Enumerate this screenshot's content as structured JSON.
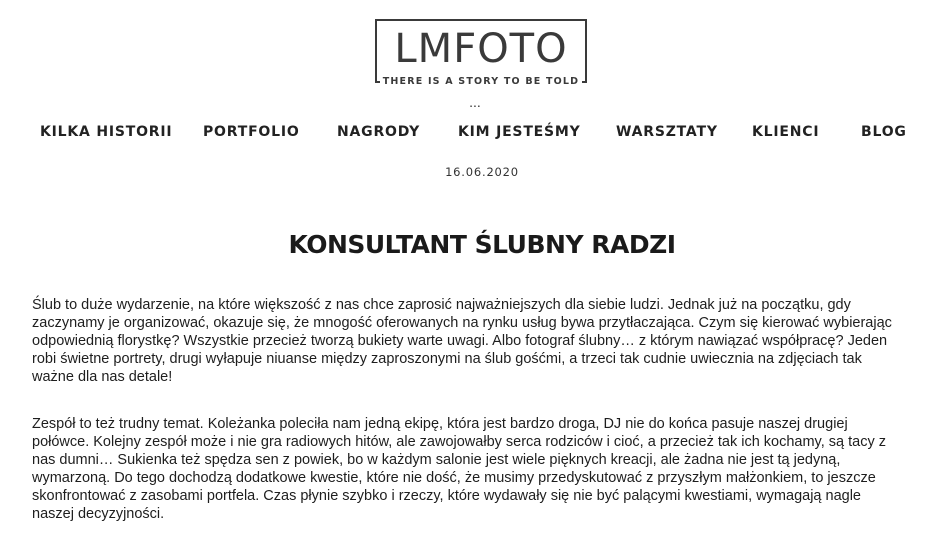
{
  "header": {
    "logo": {
      "wordmark": "LMFOTO",
      "tagline": "THERE IS A STORY TO BE TOLD"
    },
    "ellipsis": "..."
  },
  "nav": {
    "items": [
      {
        "label": "KILKA HISTORII"
      },
      {
        "label": "PORTFOLIO"
      },
      {
        "label": "NAGRODY"
      },
      {
        "label": "KIM JESTEŚMY"
      },
      {
        "label": "WARSZTATY"
      },
      {
        "label": "KLIENCI"
      },
      {
        "label": "BLOG"
      }
    ]
  },
  "article": {
    "date": "16.06.2020",
    "title": "KONSULTANT ŚLUBNY RADZI",
    "paragraphs": [
      {
        "lines": [
          "Ślub to duże wydarzenie, na które większość z nas chce zaprosić najważniejszych dla siebie ludzi. Jednak już na początku, gdy",
          "zaczynamy je organizować, okazuje się, że mnogość oferowanych na rynku usług bywa przytłaczająca. Czym się kierować wybierając",
          "odpowiednią florystkę? Wszystkie przecież tworzą bukiety warte uwagi. Albo fotograf ślubny… z którym nawiązać współpracę? Jeden",
          "robi świetne portrety, drugi wyłapuje niuanse między zaproszonymi na ślub gośćmi, a trzeci tak cudnie uwiecznia na zdjęciach tak",
          "ważne dla nas detale!"
        ]
      },
      {
        "lines": [
          "Zespół to też trudny temat. Koleżanka poleciła nam jedną ekipę, która jest bardzo droga, DJ nie do końca pasuje naszej drugiej",
          "połówce. Kolejny zespół może i nie gra radiowych hitów, ale zawojowałby serca rodziców i cioć, a przecież tak ich kochamy, są tacy z",
          "nas dumni…  Sukienka też spędza sen z powiek, bo w każdym salonie jest wiele pięknych kreacji, ale żadna nie jest tą jedyną,",
          "wymarzoną. Do tego dochodzą dodatkowe kwestie, które nie dość, że musimy przedyskutować z przyszłym małżonkiem, to jeszcze",
          "skonfrontować z zasobami portfela. Czas płynie szybko i rzeczy, które wydawały się nie być palącymi kwestiami, wymagają nagle",
          "naszej decyzyjności."
        ]
      }
    ]
  }
}
